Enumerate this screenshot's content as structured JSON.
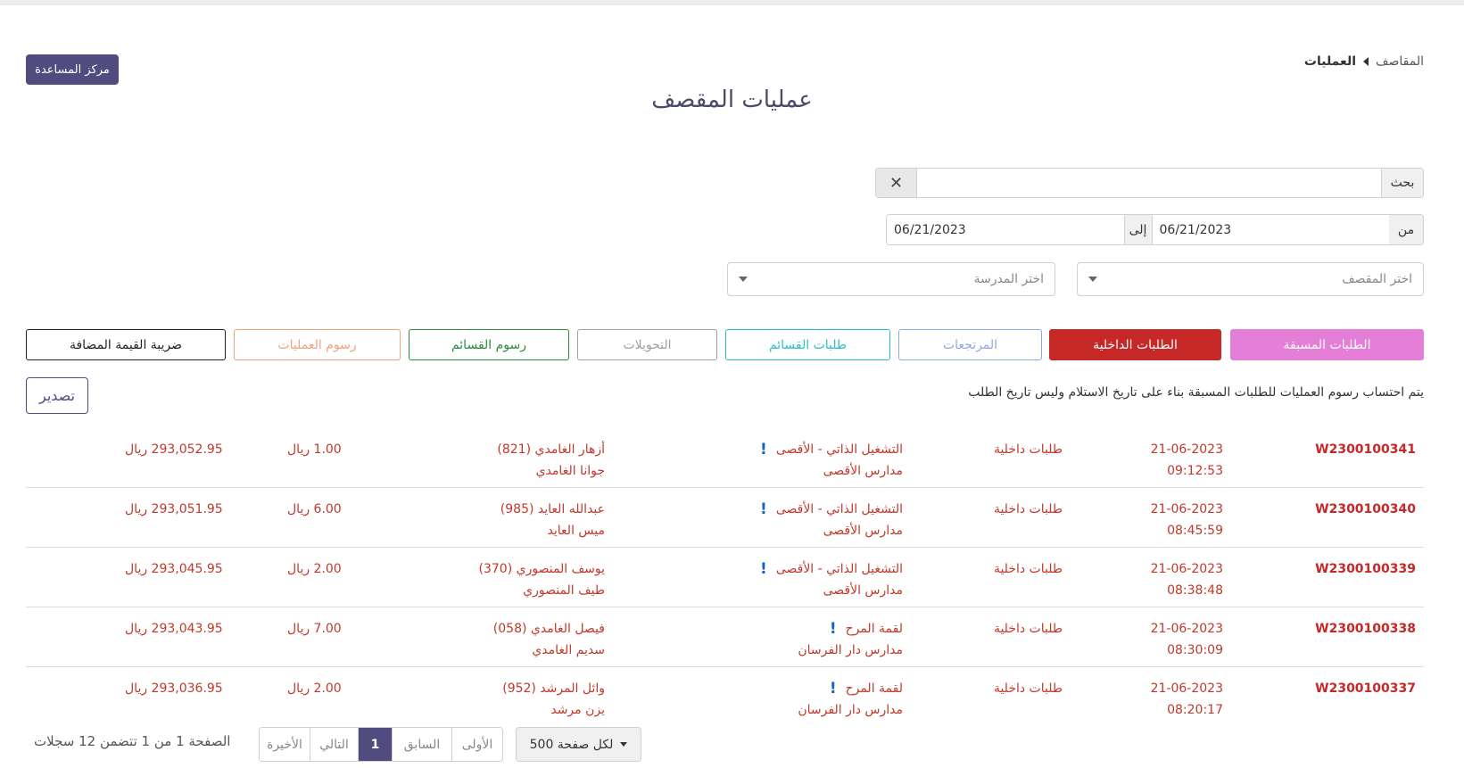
{
  "help_button": "مركز المساعدة",
  "breadcrumb": {
    "root": "المقاصف",
    "current": "العمليات"
  },
  "page_title": "عمليات المقصف",
  "search": {
    "label": "بحث",
    "value": "",
    "clear": "✕"
  },
  "dates": {
    "from_label": "من",
    "from_value": "06/21/2023",
    "to_label": "إلى",
    "to_value": "06/21/2023"
  },
  "selects": {
    "canteen_placeholder": "اختر المقصف",
    "school_placeholder": "اختر المدرسة"
  },
  "tabs": [
    {
      "label": "الطلبات المسبقة",
      "color": "#e57ed7",
      "style": "filled"
    },
    {
      "label": "الطلبات الداخلية",
      "color": "#c62828",
      "style": "filled"
    },
    {
      "label": "المرتجعات",
      "color": "#8fa8e0",
      "style": "outline"
    },
    {
      "label": "طلبات القسائم",
      "color": "#2bbfc4",
      "style": "outline"
    },
    {
      "label": "التحويلات",
      "color": "#a0a0a0",
      "style": "outline"
    },
    {
      "label": "رسوم القسائم",
      "color": "#2e8b3e",
      "style": "outline"
    },
    {
      "label": "رسوم العمليات",
      "color": "#f0a27a",
      "style": "outline"
    },
    {
      "label": "ضريبة القيمة المضافة",
      "color": "#222222",
      "style": "outline"
    }
  ],
  "note": "يتم احتساب رسوم العمليات للطلبات المسبقة بناء على تاريخ الاستلام وليس تاريخ الطلب",
  "export_button": "تصدير",
  "rows": [
    {
      "id": "W2300100341",
      "date": "21-06-2023",
      "time": "09:12:53",
      "type": "طلبات داخلية",
      "place": "التشغيل الذاتي - الأقصى",
      "school": "مدارس الأقصى",
      "person": "أزهار الغامدي (821)",
      "student": "جوانا الغامدي",
      "amount": "1.00 ريال",
      "balance": "293,052.95 ريال"
    },
    {
      "id": "W2300100340",
      "date": "21-06-2023",
      "time": "08:45:59",
      "type": "طلبات داخلية",
      "place": "التشغيل الذاتي - الأقصى",
      "school": "مدارس الأقصى",
      "person": "عبدالله العايد (985)",
      "student": "ميس العايد",
      "amount": "6.00 ريال",
      "balance": "293,051.95 ريال"
    },
    {
      "id": "W2300100339",
      "date": "21-06-2023",
      "time": "08:38:48",
      "type": "طلبات داخلية",
      "place": "التشغيل الذاتي - الأقصى",
      "school": "مدارس الأقصى",
      "person": "يوسف المنصوري (370)",
      "student": "طيف المنصوري",
      "amount": "2.00 ريال",
      "balance": "293,045.95 ريال"
    },
    {
      "id": "W2300100338",
      "date": "21-06-2023",
      "time": "08:30:09",
      "type": "طلبات داخلية",
      "place": "لقمة المرح",
      "school": "مدارس دار الفرسان",
      "person": "فيصل الغامدي (058)",
      "student": "سديم الغامدي",
      "amount": "7.00 ريال",
      "balance": "293,043.95 ريال"
    },
    {
      "id": "W2300100337",
      "date": "21-06-2023",
      "time": "08:20:17",
      "type": "طلبات داخلية",
      "place": "لقمة المرح",
      "school": "مدارس دار الفرسان",
      "person": "وائل المرشد (952)",
      "student": "يزن مرشد",
      "amount": "2.00 ريال",
      "balance": "293,036.95 ريال"
    }
  ],
  "pagination": {
    "per_page": "500 لكل صفحة",
    "first": "الأولى",
    "prev": "السابق",
    "current": "1",
    "next": "التالي",
    "last": "الأخيرة",
    "info": "الصفحة 1 من 1 تتضمن 12 سجلات"
  },
  "colors": {
    "primary": "#514b7f",
    "row_text": "#c0392b",
    "alert_icon": "#1565c0"
  },
  "icons": {
    "row_alert": "exclamation-icon",
    "breadcrumb_sep": "caret-left-icon"
  }
}
